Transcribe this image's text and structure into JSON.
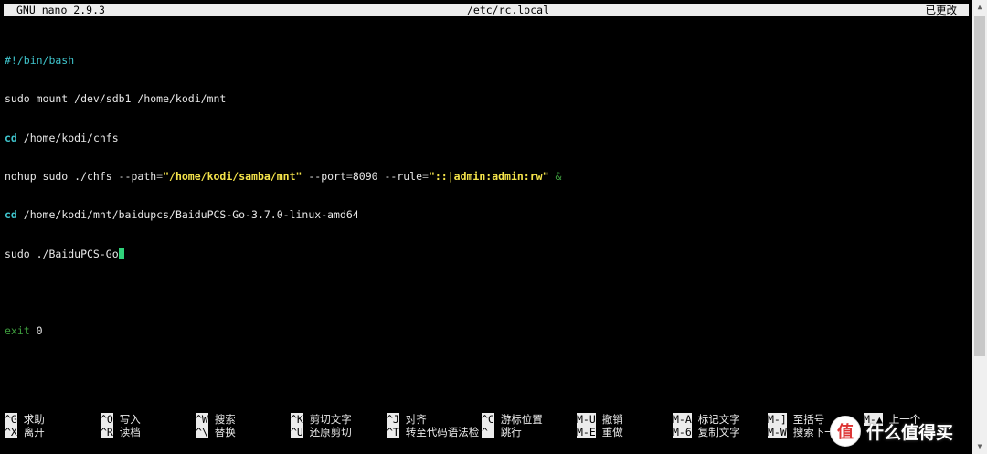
{
  "titlebar": {
    "app": "GNU nano 2.9.3",
    "filename": "/etc/rc.local",
    "status": "已更改"
  },
  "editor": {
    "line1": {
      "text": "#!/bin/bash"
    },
    "line2": {
      "text": "sudo mount /dev/sdb1 /home/kodi/mnt"
    },
    "line3": {
      "cmd": "cd",
      "rest": " /home/kodi/chfs"
    },
    "line4": {
      "p1": "nohup sudo ./chfs --path",
      "eq1": "=",
      "q1": "\"/home/kodi/samba/mnt\"",
      "p2": " --port",
      "eq2": "=",
      "p3": "8090 --rule",
      "eq3": "=",
      "q2": "\"::|admin:admin:rw\"",
      "amp": " &"
    },
    "line5": {
      "cmd": "cd",
      "rest": " /home/kodi/mnt/baidupcs/BaiduPCS-Go-3.7.0-linux-amd64"
    },
    "line6": {
      "text": "sudo ./BaiduPCS-Go"
    },
    "line8": {
      "cmd": "exit",
      "rest": " 0"
    }
  },
  "shortcuts": [
    {
      "key": "^G",
      "label": "求助"
    },
    {
      "key": "^O",
      "label": "写入"
    },
    {
      "key": "^W",
      "label": "搜索"
    },
    {
      "key": "^K",
      "label": "剪切文字"
    },
    {
      "key": "^J",
      "label": "对齐"
    },
    {
      "key": "^C",
      "label": "游标位置"
    },
    {
      "key": "M-U",
      "label": "撤销"
    },
    {
      "key": "M-A",
      "label": "标记文字"
    },
    {
      "key": "M-]",
      "label": "至括号"
    },
    {
      "key": "M-▲",
      "label": "上一个"
    },
    {
      "key": "^X",
      "label": "离开"
    },
    {
      "key": "^R",
      "label": "读档"
    },
    {
      "key": "^\\",
      "label": "替换"
    },
    {
      "key": "^U",
      "label": "还原剪切"
    },
    {
      "key": "^T",
      "label": "转至代码语法检"
    },
    {
      "key": "^_",
      "label": "跳行"
    },
    {
      "key": "M-E",
      "label": "重做"
    },
    {
      "key": "M-6",
      "label": "复制文字"
    },
    {
      "key": "M-W",
      "label": "搜索下一"
    }
  ],
  "watermark": {
    "logo": "值",
    "text": "什么值得买"
  },
  "colors": {
    "background": "#000000",
    "titlebar": "#ececec",
    "teal": "#3fc4cc",
    "yellow": "#f3e24a",
    "green": "#3e9e3e",
    "cursor": "#2fd27a"
  }
}
